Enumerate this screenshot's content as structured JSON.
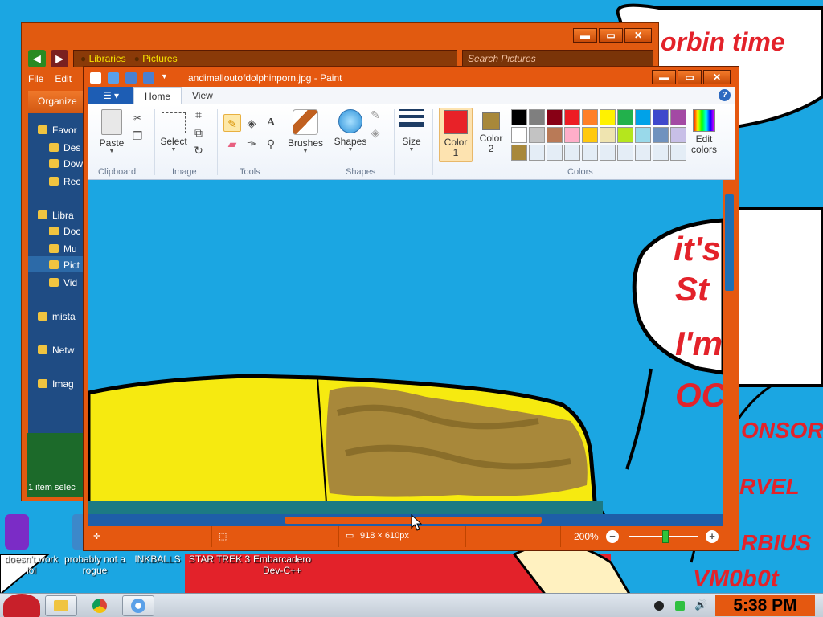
{
  "wallpaper": {
    "texts": {
      "corbin": "orbin  time",
      "its": "it's",
      "st": "St",
      "im": "I'm",
      "oc": "OC",
      "sponsored": "ONSORE",
      "marvel": "RVEL",
      "morbius": "RBIUS",
      "vm": "VM0b0t"
    },
    "text_color": "#e3222a"
  },
  "desktop_icons": [
    {
      "label": "doesn't work lol",
      "color": "#7b2cc6"
    },
    {
      "label": "probably not a rogue",
      "color": "#4a7cc0"
    },
    {
      "label": "INKBALLS"
    },
    {
      "label": "STAR TREK 3"
    },
    {
      "label": "Embarcadero Dev-C++"
    }
  ],
  "explorer": {
    "breadcrumb": [
      "Libraries",
      "Pictures"
    ],
    "search_placeholder": "Search Pictures",
    "menu": [
      "File",
      "Edit"
    ],
    "organize": "Organize",
    "nav": [
      "Favor",
      "Des",
      "Dow",
      "Rec",
      "Libra",
      "Doc",
      "Mu",
      "Pict",
      "Vid",
      "mista",
      "Netw",
      "Imag"
    ],
    "status": "1 item selec"
  },
  "paint": {
    "title": "andimalloutofdolphinporn.jpg - Paint",
    "tabs": [
      "Home",
      "View"
    ],
    "help": "?",
    "groups": {
      "clipboard": "Clipboard",
      "image": "Image",
      "tools": "Tools",
      "shapes": "Shapes",
      "colors": "Colors"
    },
    "buttons": {
      "paste": "Paste",
      "select": "Select",
      "brushes": "Brushes",
      "shapes": "Shapes",
      "size": "Size",
      "color1": "Color\n1",
      "color2": "Color\n2",
      "edit_colors": "Edit\ncolors"
    },
    "color1": "#e82228",
    "color2": "#a8883a",
    "palette": [
      "#000000",
      "#7f7f7f",
      "#880015",
      "#ed1c24",
      "#ff7f27",
      "#fff200",
      "#22b14c",
      "#00a2e8",
      "#3f48cc",
      "#a349a4",
      "#ffffff",
      "#c3c3c3",
      "#b97a57",
      "#ffaec9",
      "#ffc90e",
      "#efe4b0",
      "#b5e61d",
      "#99d9ea",
      "#7092be",
      "#c8bfe7",
      "#a8883a",
      "#e4edf6",
      "#e4edf6",
      "#e4edf6",
      "#e4edf6",
      "#e4edf6",
      "#e4edf6",
      "#e4edf6",
      "#e4edf6",
      "#e4edf6"
    ],
    "status": {
      "dimensions": "918 × 610px",
      "zoom": "200%"
    }
  },
  "taskbar": {
    "clock": "5:38 PM"
  }
}
